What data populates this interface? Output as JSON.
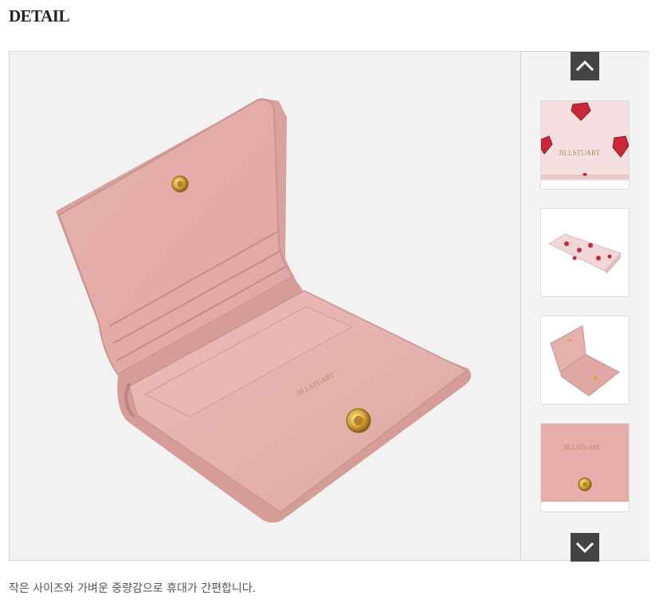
{
  "section_title": "DETAIL",
  "caption": "작은 사이즈와 가벼운 중량감으로 휴대가 간편합니다.",
  "main_image": {
    "icon": "wallet-open-image",
    "brand_print": "JILLSTUART"
  },
  "thumbnails": [
    {
      "icon": "heart-print-closeup-thumbnail",
      "brand_print": "JILLSTUART"
    },
    {
      "icon": "heart-print-wallet-thumbnail"
    },
    {
      "icon": "pink-wallet-open-thumbnail"
    },
    {
      "icon": "logo-snap-closeup-thumbnail",
      "brand_print": "JILLSTUART"
    }
  ],
  "controls": {
    "up_icon": "chevron-up-icon",
    "down_icon": "chevron-down-icon"
  },
  "colors": {
    "wallet_pink": "#e8b3b0",
    "wallet_shadow": "#c98f8c",
    "gold": "#d8a93a",
    "arrow_bg": "#444444",
    "heart_red": "#c8283a"
  }
}
